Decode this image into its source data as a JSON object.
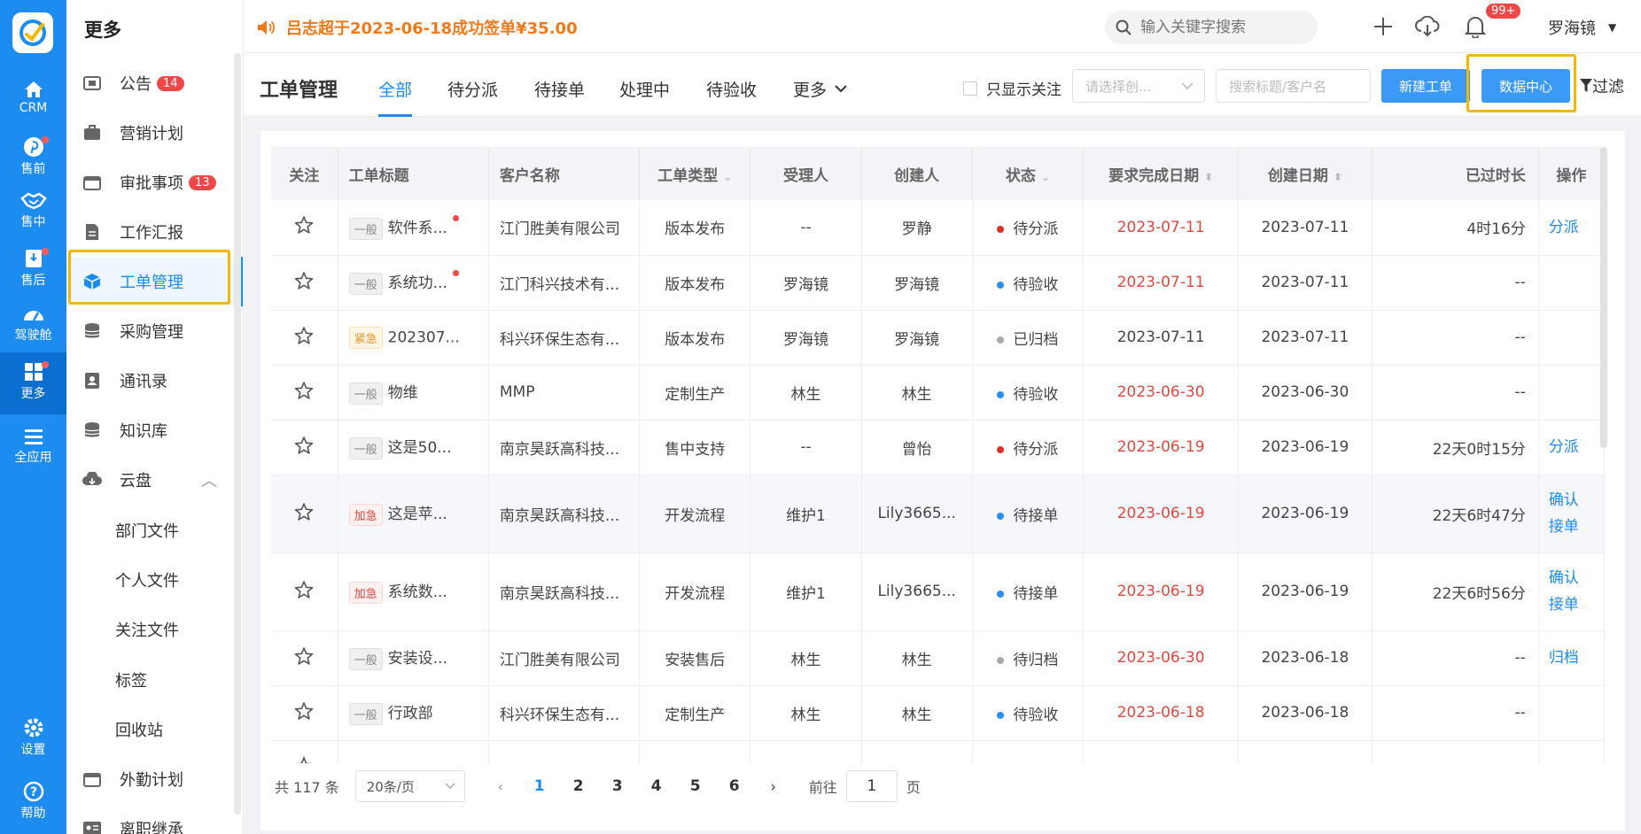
{
  "rail": {
    "items": [
      {
        "label": "CRM",
        "icon": "home-icon"
      },
      {
        "label": "售前",
        "icon": "pinterest-icon"
      },
      {
        "label": "售中",
        "icon": "handshake-icon"
      },
      {
        "label": "售后",
        "icon": "service-icon"
      },
      {
        "label": "驾驶舱",
        "icon": "dashboard-icon"
      },
      {
        "label": "更多",
        "icon": "grid-icon"
      },
      {
        "label": "全应用",
        "icon": "menu-icon"
      },
      {
        "label": "设置",
        "icon": "gear-icon"
      },
      {
        "label": "帮助",
        "icon": "help-icon"
      }
    ]
  },
  "sidebar": {
    "title": "更多",
    "items": [
      {
        "label": "公告",
        "badge": "14"
      },
      {
        "label": "营销计划"
      },
      {
        "label": "审批事项",
        "badge": "13"
      },
      {
        "label": "工作汇报"
      },
      {
        "label": "工单管理"
      },
      {
        "label": "采购管理"
      },
      {
        "label": "通讯录"
      },
      {
        "label": "知识库"
      },
      {
        "label": "云盘"
      },
      {
        "label": "部门文件"
      },
      {
        "label": "个人文件"
      },
      {
        "label": "关注文件"
      },
      {
        "label": "标签"
      },
      {
        "label": "回收站"
      },
      {
        "label": "外勤计划"
      },
      {
        "label": "离职继承"
      }
    ]
  },
  "topbar": {
    "notice": "吕志超于2023-06-18成功签单¥35.00",
    "search_placeholder": "输入关键字搜索",
    "notif_badge": "99+",
    "user": "罗海镜"
  },
  "header": {
    "title": "工单管理",
    "tabs": [
      "全部",
      "待分派",
      "待接单",
      "处理中",
      "待验收",
      "更多"
    ],
    "only_follow": "只显示关注",
    "creator_placeholder": "请选择创...",
    "search_placeholder": "搜索标题/客户名",
    "new_button": "新建工单",
    "data_center_button": "数据中心",
    "filter": "过滤"
  },
  "table": {
    "columns": [
      "关注",
      "工单标题",
      "客户名称",
      "工单类型",
      "受理人",
      "创建人",
      "状态",
      "要求完成日期",
      "创建日期",
      "已过时长",
      "操作"
    ],
    "rows": [
      {
        "tag": "一般",
        "title": "软件系...",
        "customer": "江门胜美有限公司",
        "type": "版本发布",
        "assignee": "--",
        "creator": "罗静",
        "status": "待分派",
        "due": "2023-07-11",
        "created": "2023-07-11",
        "elapsed": "4时16分",
        "op": "分派"
      },
      {
        "tag": "一般",
        "title": "系统功...",
        "customer": "江门科兴技术有...",
        "type": "版本发布",
        "assignee": "罗海镜",
        "creator": "罗海镜",
        "status": "待验收",
        "due": "2023-07-11",
        "created": "2023-07-11",
        "elapsed": "--",
        "op": ""
      },
      {
        "tag": "紧急",
        "title": "202307...",
        "customer": "科兴环保生态有...",
        "type": "版本发布",
        "assignee": "罗海镜",
        "creator": "罗海镜",
        "status": "已归档",
        "due": "2023-07-11",
        "created": "2023-07-11",
        "elapsed": "--",
        "op": ""
      },
      {
        "tag": "一般",
        "title": "物维",
        "customer": "MMP",
        "type": "定制生产",
        "assignee": "林生",
        "creator": "林生",
        "status": "待验收",
        "due": "2023-06-30",
        "created": "2023-06-30",
        "elapsed": "--",
        "op": ""
      },
      {
        "tag": "一般",
        "title": "这是50...",
        "customer": "南京昊跃高科技...",
        "type": "售中支持",
        "assignee": "--",
        "creator": "曾怡",
        "status": "待分派",
        "due": "2023-06-19",
        "created": "2023-06-19",
        "elapsed": "22天0时15分",
        "op": "分派"
      },
      {
        "tag": "加急",
        "title": "这是苹...",
        "customer": "南京昊跃高科技...",
        "type": "开发流程",
        "assignee": "维护1",
        "creator": "Lily3665...",
        "status": "待接单",
        "due": "2023-06-19",
        "created": "2023-06-19",
        "elapsed": "22天6时47分",
        "op": "确认接单"
      },
      {
        "tag": "加急",
        "title": "系统数...",
        "customer": "南京昊跃高科技...",
        "type": "开发流程",
        "assignee": "维护1",
        "creator": "Lily3665...",
        "status": "待接单",
        "due": "2023-06-19",
        "created": "2023-06-19",
        "elapsed": "22天6时56分",
        "op": "确认接单"
      },
      {
        "tag": "一般",
        "title": "安装设...",
        "customer": "江门胜美有限公司",
        "type": "安装售后",
        "assignee": "林生",
        "creator": "林生",
        "status": "待归档",
        "due": "2023-06-30",
        "created": "2023-06-18",
        "elapsed": "--",
        "op": "归档"
      },
      {
        "tag": "一般",
        "title": "行政部",
        "customer": "科兴环保生态有...",
        "type": "定制生产",
        "assignee": "林生",
        "creator": "林生",
        "status": "待验收",
        "due": "2023-06-18",
        "created": "2023-06-18",
        "elapsed": "--",
        "op": ""
      }
    ]
  },
  "pager": {
    "total": "共 117 条",
    "page_size": "20条/页",
    "pages": [
      "1",
      "2",
      "3",
      "4",
      "5",
      "6"
    ],
    "goto_prefix": "前往",
    "goto_value": "1",
    "goto_suffix": "页"
  },
  "colors": {
    "accent": "#1c8cf0",
    "danger": "#e0483e",
    "notice": "#f07a1a"
  }
}
